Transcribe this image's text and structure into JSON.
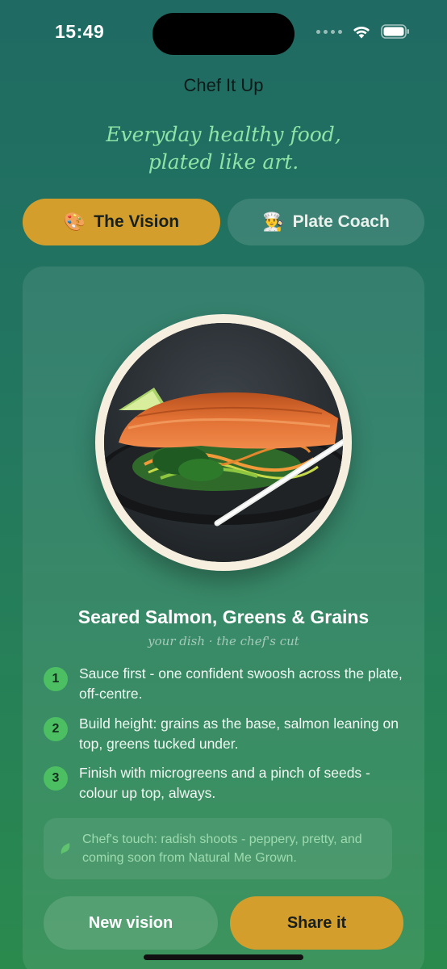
{
  "status_bar": {
    "time": "15:49"
  },
  "header": {
    "title": "Chef It Up",
    "tagline_line1": "Everyday healthy food,",
    "tagline_line2": "plated like art."
  },
  "tabs": [
    {
      "emoji": "🎨",
      "label": "The Vision",
      "active": true
    },
    {
      "emoji": "👨‍🍳",
      "label": "Plate Coach",
      "active": false
    }
  ],
  "dish": {
    "title": "Seared Salmon, Greens & Grains",
    "subtitle": "your dish · the chef's cut"
  },
  "steps": [
    {
      "number": "1",
      "text": "Sauce first - one confident swoosh across the plate, off-centre."
    },
    {
      "number": "2",
      "text": "Build height: grains as the base, salmon leaning on top, greens tucked under."
    },
    {
      "number": "3",
      "text": "Finish with microgreens and a pinch of seeds - colour up top, always."
    }
  ],
  "chefs_touch": "Chef's touch: radish shoots - peppery, pretty, and coming soon from Natural Me Grown.",
  "actions": {
    "new_label": "New vision",
    "share_label": "Share it"
  },
  "colors": {
    "accent": "#d39e2c",
    "step_badge": "#4bbf62",
    "tagline": "#8ee3a6",
    "background_top": "#1f6a63",
    "background_bottom": "#2a8a4e"
  },
  "icons": [
    "wifi-icon",
    "battery-icon",
    "signal-icon",
    "palette-icon",
    "chef-icon",
    "leaf-icon"
  ]
}
